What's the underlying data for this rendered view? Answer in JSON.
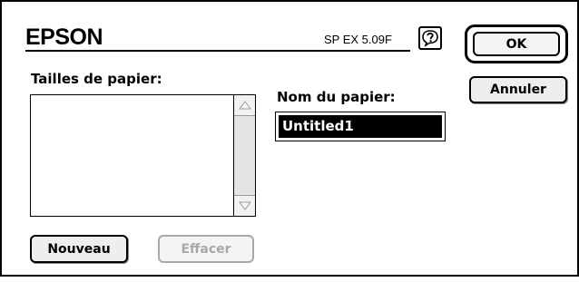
{
  "header": {
    "logo": "EPSON",
    "version": "SP EX 5.09F"
  },
  "buttons": {
    "ok": "OK",
    "cancel": "Annuler",
    "new": "Nouveau",
    "delete": "Effacer"
  },
  "paper_sizes": {
    "label": "Tailles de papier:",
    "items": []
  },
  "paper_name": {
    "label": "Nom du papier:",
    "value": "Untitled1"
  },
  "icons": {
    "help": "help-balloon-icon",
    "scroll_up": "arrow-up-icon",
    "scroll_down": "arrow-down-icon"
  }
}
